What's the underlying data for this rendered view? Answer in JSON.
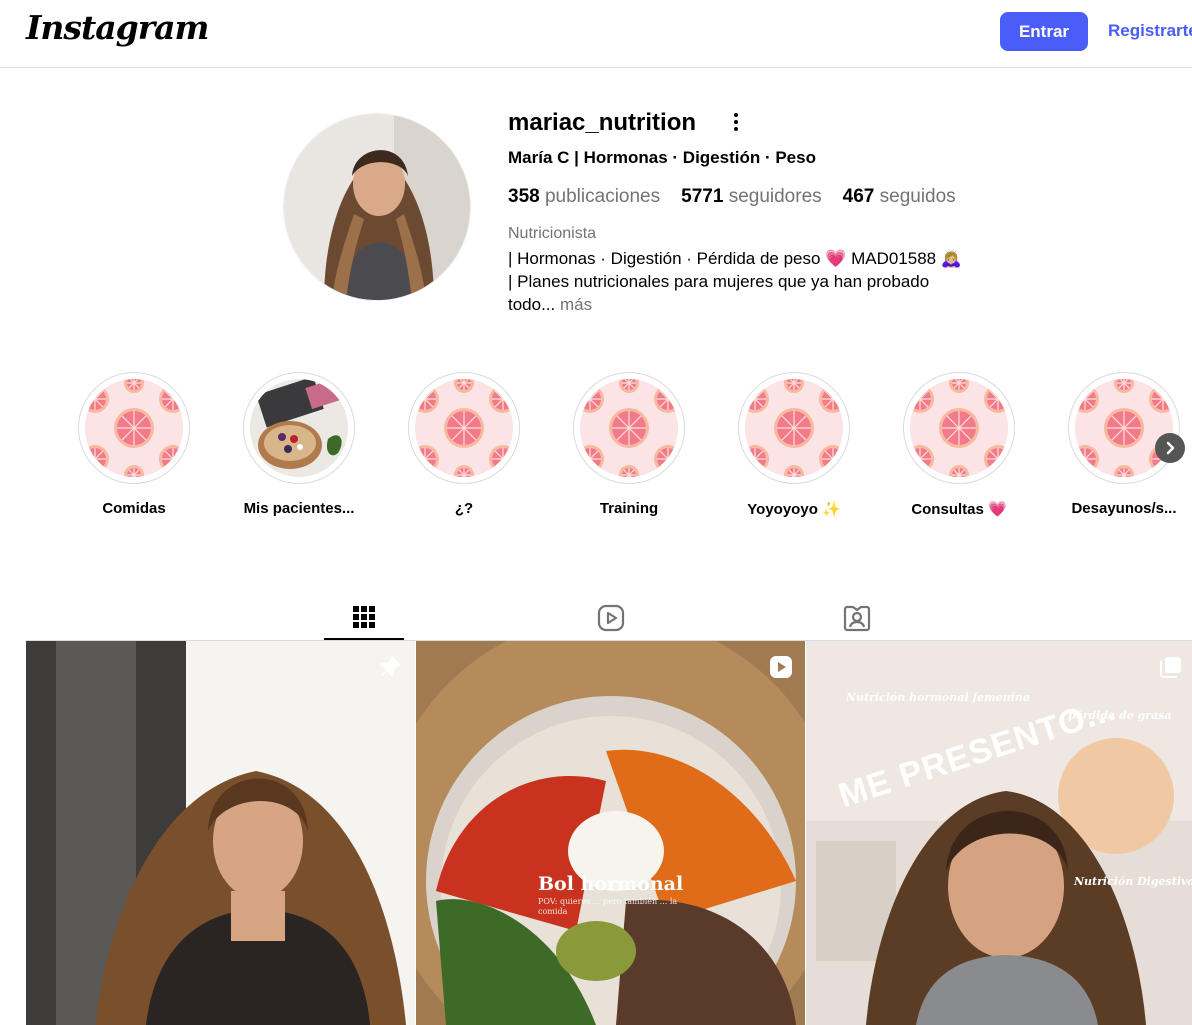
{
  "header": {
    "logo": "Instagram",
    "login_label": "Entrar",
    "signup_label": "Registrarte"
  },
  "profile": {
    "username": "mariac_nutrition",
    "full_name": "María C | Hormonas · Digestión · Peso",
    "stats": {
      "posts_count": "358",
      "posts_label": "publicaciones",
      "followers_count": "5771",
      "followers_label": "seguidores",
      "following_count": "467",
      "following_label": "seguidos"
    },
    "category": "Nutricionista",
    "bio_line1": "| Hormonas · Digestión · Pérdida de peso 💗 MAD01588 🙇🏼‍♀️",
    "bio_line2": "| Planes nutricionales para mujeres que ya han probado",
    "bio_line3": "todo...",
    "bio_more": "más"
  },
  "highlights": [
    {
      "label": "Comidas",
      "cover": "grapefruit"
    },
    {
      "label": "Mis pacientes...",
      "cover": "photo"
    },
    {
      "label": "¿?",
      "cover": "grapefruit"
    },
    {
      "label": "Training",
      "cover": "grapefruit"
    },
    {
      "label": "Yoyoyoyo ✨",
      "cover": "grapefruit"
    },
    {
      "label": "Consultas 💗",
      "cover": "grapefruit"
    },
    {
      "label": "Desayunos/s...",
      "cover": "grapefruit"
    }
  ],
  "tabs": [
    {
      "name": "posts",
      "icon": "grid-icon",
      "active": true
    },
    {
      "name": "reels",
      "icon": "reels-icon",
      "active": false
    },
    {
      "name": "tagged",
      "icon": "tagged-icon",
      "active": false
    }
  ],
  "posts": [
    {
      "type": "pinned-photo",
      "badge": "pin-icon"
    },
    {
      "type": "reel",
      "badge": "reel-icon",
      "overlay_title": "Bol hormonal",
      "overlay_sub": "POV: quieres ... pero también ... la comida"
    },
    {
      "type": "carousel",
      "badge": "carousel-icon",
      "overlay_title": "ME PRESENTO...",
      "note1": "Nutrición hormonal femenina",
      "note2": "pérdida de grasa",
      "note3": "Nutrición Digestiva"
    }
  ],
  "colors": {
    "accent": "#4a5df9",
    "secondary_text": "#737373",
    "divider": "#dbdbdb",
    "highlight_bg": "#fbe3e6",
    "grapefruit": "#f37a8a"
  }
}
